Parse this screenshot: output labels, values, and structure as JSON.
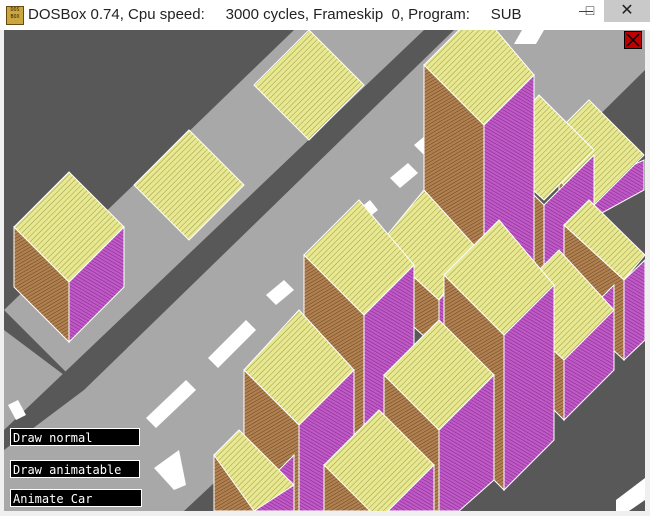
{
  "window": {
    "title": "DOSBox 0.74, Cpu speed:     3000 cycles, Frameskip  0, Program:     SUB",
    "icon_text": "DOS BOX",
    "minimize_symbol": "—",
    "maximize_symbol": "□",
    "close_symbol": "✕"
  },
  "menu": {
    "draw_normal": "Draw normal",
    "draw_animatable": "Draw animatable",
    "animate_car": "Animate Car"
  },
  "colors": {
    "ground": "#585858",
    "road": "#a8a8a8",
    "lane_marking": "#ffffff",
    "roof": "#e8e890",
    "wall_left": "#a87c4c",
    "wall_right": "#b84cc0",
    "edge": "#ffffff",
    "close_box": "#c00000"
  },
  "icons": [
    "dosbox-app-icon",
    "minimize-icon",
    "maximize-icon",
    "close-icon",
    "scene-close-icon"
  ]
}
